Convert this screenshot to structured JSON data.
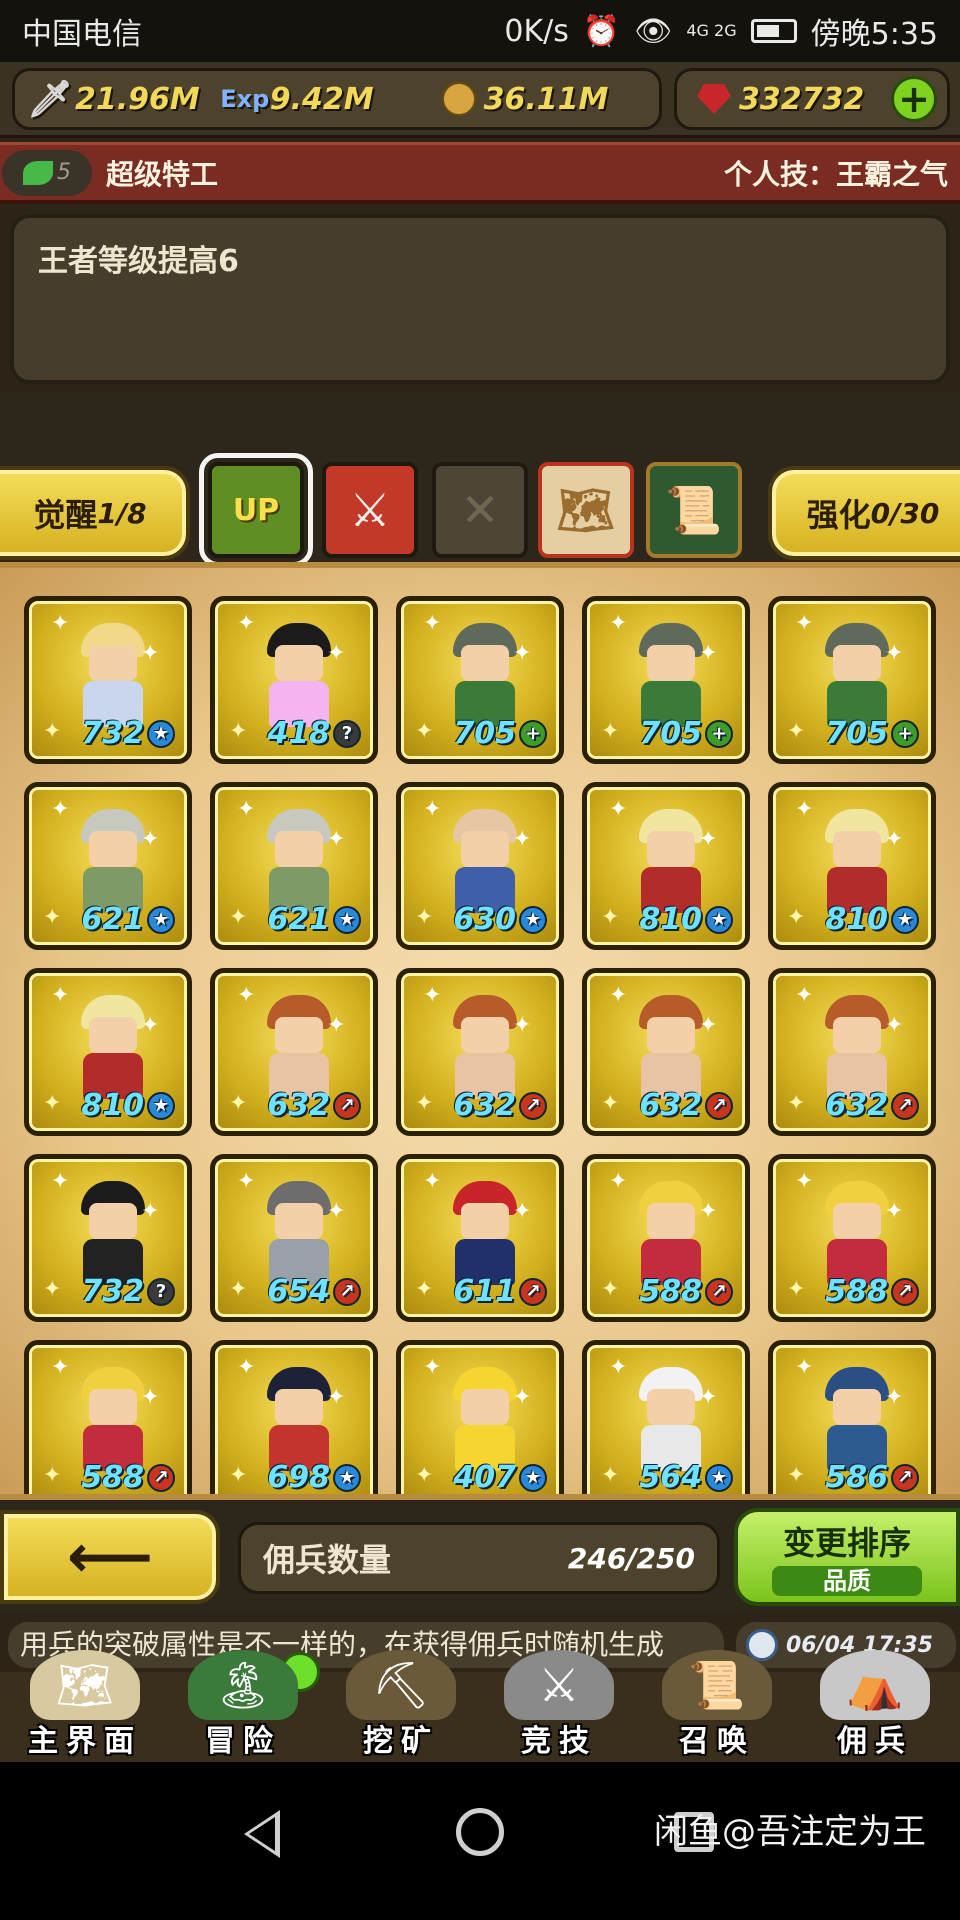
{
  "statusbar": {
    "carrier": "中国电信",
    "speed": "0K/s",
    "network": "4G 2G",
    "time": "傍晚5:35"
  },
  "resources": {
    "attack": "21.96M",
    "exp_label": "Exp",
    "exp": "9.42M",
    "gold": "36.11M",
    "gems": "332732",
    "plus": "+"
  },
  "hero": {
    "level": "5",
    "name": "超级特工",
    "skill": "个人技：王霸之气",
    "description": "王者等级提高6"
  },
  "tabs": {
    "awaken_label": "觉醒",
    "awaken_value": "1/8",
    "crown_label": "UP",
    "enhance_label": "强化",
    "enhance_value": "0/30"
  },
  "cards": [
    {
      "power": "732",
      "type": "star"
    },
    {
      "power": "418",
      "type": "q"
    },
    {
      "power": "705",
      "type": "plus"
    },
    {
      "power": "705",
      "type": "plus"
    },
    {
      "power": "705",
      "type": "plus"
    },
    {
      "power": "621",
      "type": "star"
    },
    {
      "power": "621",
      "type": "star"
    },
    {
      "power": "630",
      "type": "star"
    },
    {
      "power": "810",
      "type": "star"
    },
    {
      "power": "810",
      "type": "star"
    },
    {
      "power": "810",
      "type": "star"
    },
    {
      "power": "632",
      "type": "arrow"
    },
    {
      "power": "632",
      "type": "arrow"
    },
    {
      "power": "632",
      "type": "arrow"
    },
    {
      "power": "632",
      "type": "arrow"
    },
    {
      "power": "732",
      "type": "q"
    },
    {
      "power": "654",
      "type": "arrow"
    },
    {
      "power": "611",
      "type": "arrow"
    },
    {
      "power": "588",
      "type": "arrow"
    },
    {
      "power": "588",
      "type": "arrow"
    },
    {
      "power": "588",
      "type": "arrow"
    },
    {
      "power": "698",
      "type": "star"
    },
    {
      "power": "407",
      "type": "star"
    },
    {
      "power": "564",
      "type": "star"
    },
    {
      "power": "586",
      "type": "arrow"
    }
  ],
  "type_glyphs": {
    "star": "★",
    "q": "?",
    "plus": "+",
    "arrow": "↗"
  },
  "bottom": {
    "back_arrow": "⟵",
    "count_label": "佣兵数量",
    "count_value": "246/250",
    "sort_label": "变更排序",
    "sort_mode": "品质"
  },
  "tip": {
    "text": "用兵的突破属性是不一样的，在获得佣兵时随机生成",
    "time": "06/04 17:35"
  },
  "nav": [
    {
      "label": "主界面",
      "icon": "scroll-map-icon"
    },
    {
      "label": "冒险",
      "icon": "island-icon"
    },
    {
      "label": "挖矿",
      "icon": "pickaxe-icon"
    },
    {
      "label": "竞技",
      "icon": "crossed-swords-icon"
    },
    {
      "label": "召唤",
      "icon": "summon-scroll-icon"
    },
    {
      "label": "佣兵",
      "icon": "tent-icon"
    }
  ],
  "watermark": "闲鱼@吾注定为王"
}
